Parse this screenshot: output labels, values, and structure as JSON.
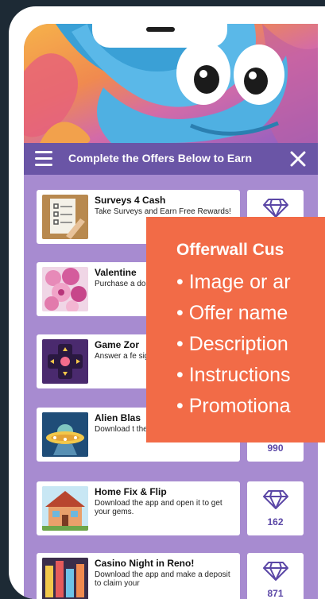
{
  "header": {
    "title": "Complete the Offers Below to Earn"
  },
  "offers": [
    {
      "name": "Surveys 4 Cash",
      "description": "Take Surveys and Earn Free Rewards!",
      "gems": ""
    },
    {
      "name": "Valentine",
      "description": "Purchase a dozen roses NEW USER",
      "gems": ""
    },
    {
      "name": "Game Zor",
      "description": "Answer a fe sign up for a valid ema",
      "gems": ""
    },
    {
      "name": "Alien Blas",
      "description": "Download t then reach your reward!",
      "gems": "990"
    },
    {
      "name": "Home Fix & Flip",
      "description": "Download the app and open it to get your gems.",
      "gems": "162"
    },
    {
      "name": "Casino Night in Reno!",
      "description": "Download the app and make a deposit to claim your",
      "gems": "871"
    }
  ],
  "overlay": {
    "title": "Offerwall Cus",
    "items": [
      "• Image or ar",
      "• Offer name",
      "• Description",
      "• Instructions",
      "• Promotiona"
    ]
  },
  "colors": {
    "header": "#6a55a6",
    "overlay": "#f26b47",
    "background": "#a78bd0"
  }
}
